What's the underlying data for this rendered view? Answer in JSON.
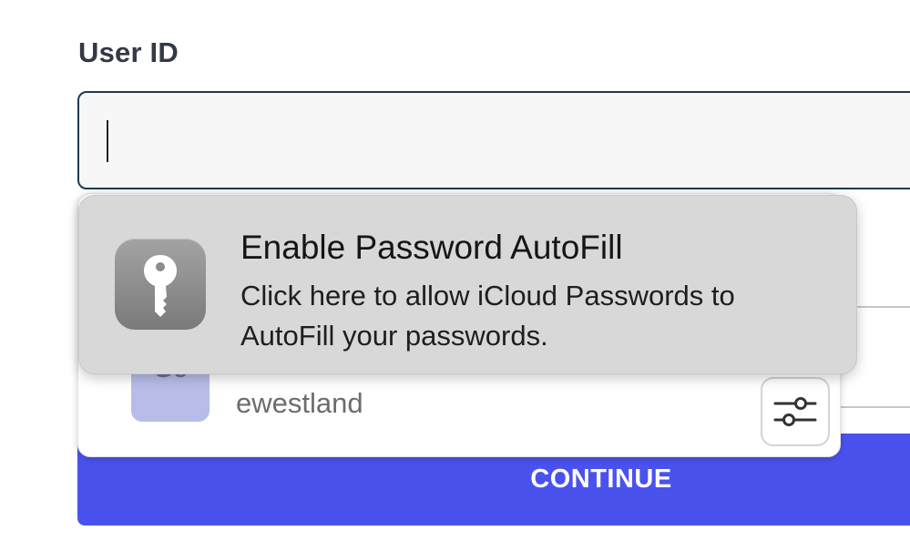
{
  "form": {
    "userid_label": "User ID",
    "userid_value": "",
    "continue_label": "CONTINUE"
  },
  "saved_account": {
    "avatar_text": "Ge",
    "username": "ewestland"
  },
  "autofill_prompt": {
    "title": "Enable Password AutoFill",
    "description": "Click here to allow iCloud Passwords to AutoFill your passwords."
  },
  "icons": {
    "key": "key-icon",
    "options": "sliders-icon"
  },
  "colors": {
    "primary_button": "#4a52ee",
    "input_border": "#1f3a52",
    "avatar_bg": "#b7bde8",
    "prompt_bg": "#d8d8d8"
  }
}
